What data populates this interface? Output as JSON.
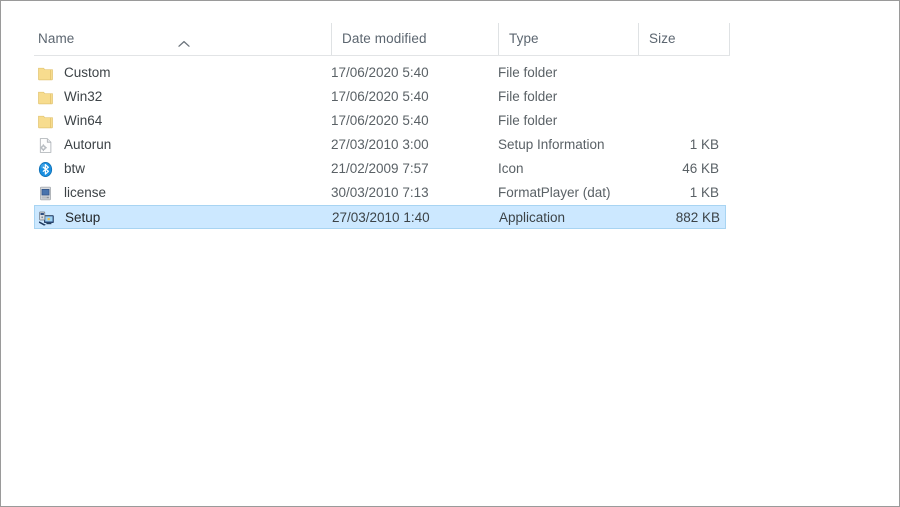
{
  "window": {
    "view_mode": "Details"
  },
  "columns": {
    "name": "Name",
    "date_modified": "Date modified",
    "type": "Type",
    "size": "Size",
    "sort": {
      "column": "Name",
      "direction": "ascending",
      "icon": "chevron-up-icon"
    }
  },
  "colors": {
    "selection_fill": "#cce8ff",
    "selection_border": "#a8d4f2",
    "folder_icon": "#f7dc8e",
    "bluetooth_icon": "#1a8fe0",
    "header_text": "#5c6670",
    "row_text": "#3d4347"
  },
  "rows": [
    {
      "name": "Custom",
      "date_modified": "17/06/2020 5:40",
      "type": "File folder",
      "size": "",
      "icon": "folder-icon",
      "selected": false
    },
    {
      "name": "Win32",
      "date_modified": "17/06/2020 5:40",
      "type": "File folder",
      "size": "",
      "icon": "folder-icon",
      "selected": false
    },
    {
      "name": "Win64",
      "date_modified": "17/06/2020 5:40",
      "type": "File folder",
      "size": "",
      "icon": "folder-icon",
      "selected": false
    },
    {
      "name": "Autorun",
      "date_modified": "27/03/2010 3:00",
      "type": "Setup Information",
      "size": "1 KB",
      "icon": "setup-information-icon",
      "selected": false
    },
    {
      "name": "btw",
      "date_modified": "21/02/2009 7:57",
      "type": "Icon",
      "size": "46 KB",
      "icon": "bluetooth-icon",
      "selected": false
    },
    {
      "name": "license",
      "date_modified": "30/03/2010 7:13",
      "type": "FormatPlayer (dat)",
      "size": "1 KB",
      "icon": "dat-file-icon",
      "selected": false
    },
    {
      "name": "Setup",
      "date_modified": "27/03/2010 1:40",
      "type": "Application",
      "size": "882 KB",
      "icon": "application-setup-icon",
      "selected": true
    }
  ]
}
